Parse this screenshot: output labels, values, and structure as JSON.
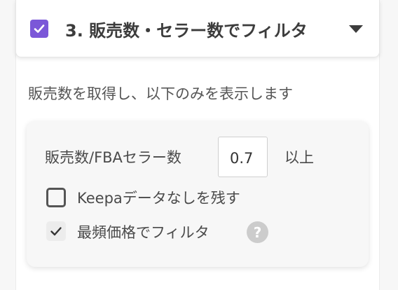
{
  "section": {
    "enabled": true,
    "title": "3. 販売数・セラー数でフィルタ",
    "accent": "#7b57d8"
  },
  "description": "販売数を取得し、以下のみを表示します",
  "filter": {
    "ratio_label": "販売数/FBAセラー数",
    "ratio_value": "0.7",
    "ratio_suffix": "以上",
    "keepa_label": "Keepaデータなしを残す",
    "keepa_checked": false,
    "mode_price_label": "最頻価格でフィルタ",
    "mode_price_checked": true,
    "help_icon_text": "?"
  },
  "icons": {
    "header_check": "checkmark-icon",
    "header_toggle": "caret-down-icon",
    "help": "question-circle-icon"
  }
}
